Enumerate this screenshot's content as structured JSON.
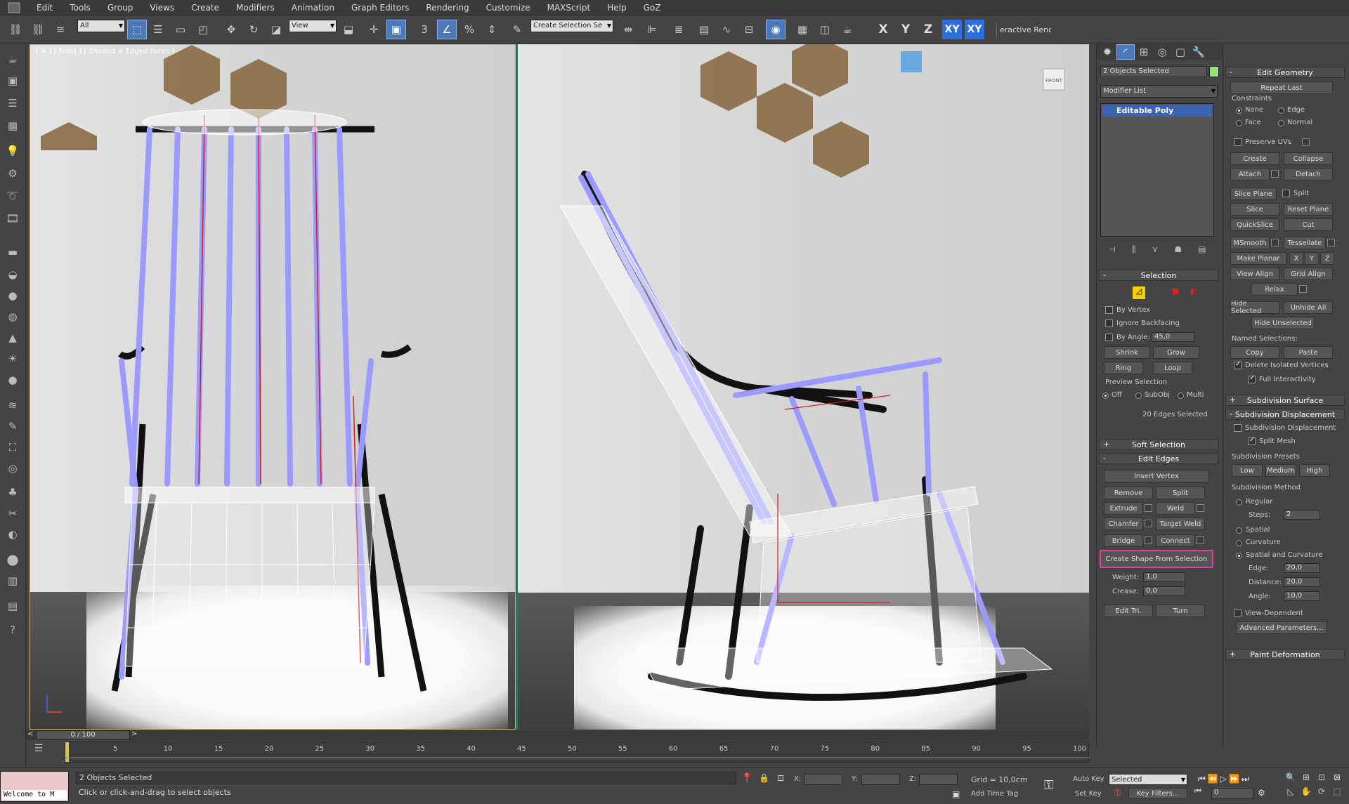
{
  "menu": [
    "Edit",
    "Tools",
    "Group",
    "Views",
    "Create",
    "Modifiers",
    "Animation",
    "Graph Editors",
    "Rendering",
    "Customize",
    "MAXScript",
    "Help",
    "GoZ"
  ],
  "toolbar": {
    "filter": "All",
    "ref_coord": "View",
    "named_sel": "Create Selection Se",
    "axes": [
      "X",
      "Y",
      "Z",
      "XY",
      "XY"
    ],
    "render_label": "eractive Rend"
  },
  "viewport_left": {
    "label": "[ + ] [ Front ] [ Shaded + Edged Faces ]"
  },
  "viewport_right": {
    "viewcube": "FRONT"
  },
  "panel": {
    "objects_selected": "2 Objects Selected",
    "modifier_list": "Modifier List",
    "stack_item": "Editable Poly",
    "selection": {
      "title": "Selection",
      "by_vertex": "By Vertex",
      "ignore_backfacing": "Ignore Backfacing",
      "by_angle": "By Angle:",
      "angle_value": "45,0",
      "shrink": "Shrink",
      "grow": "Grow",
      "ring": "Ring",
      "loop": "Loop",
      "preview": "Preview Selection",
      "off": "Off",
      "subobj": "SubObj",
      "multi": "Multi",
      "status": "20 Edges Selected"
    },
    "soft_selection": "Soft Selection",
    "edit_edges": {
      "title": "Edit Edges",
      "insert_vertex": "Insert Vertex",
      "remove": "Remove",
      "split": "Split",
      "extrude": "Extrude",
      "weld": "Weld",
      "chamfer": "Chamfer",
      "target_weld": "Target Weld",
      "bridge": "Bridge",
      "connect": "Connect",
      "create_shape": "Create Shape From Selection",
      "weight_label": "Weight:",
      "weight": "1,0",
      "crease_label": "Crease:",
      "crease": "0,0",
      "edit_tri": "Edit Tri.",
      "turn": "Turn"
    },
    "edit_geometry": {
      "title": "Edit Geometry",
      "repeat_last": "Repeat Last",
      "constraints": "Constraints",
      "none": "None",
      "edge": "Edge",
      "face": "Face",
      "normal": "Normal",
      "preserve_uvs": "Preserve UVs",
      "create": "Create",
      "collapse": "Collapse",
      "attach": "Attach",
      "detach": "Detach",
      "slice_plane": "Slice Plane",
      "split": "Split",
      "slice": "Slice",
      "reset_plane": "Reset Plane",
      "quickslice": "QuickSlice",
      "cut": "Cut",
      "msmooth": "MSmooth",
      "tessellate": "Tessellate",
      "make_planar": "Make Planar",
      "x": "X",
      "y": "Y",
      "z": "Z",
      "view_align": "View Align",
      "grid_align": "Grid Align",
      "relax": "Relax",
      "hide_selected": "Hide Selected",
      "unhide_all": "Unhide All",
      "hide_unselected": "Hide Unselected",
      "named_selections": "Named Selections:",
      "copy": "Copy",
      "paste": "Paste",
      "delete_isolated": "Delete Isolated Vertices",
      "full_interactivity": "Full Interactivity"
    },
    "subdivision_surface": "Subdivision Surface",
    "subdivision_displacement": {
      "title": "Subdivision Displacement",
      "sub_disp": "Subdivision Displacement",
      "split_mesh": "Split Mesh",
      "presets": "Subdivision Presets",
      "low": "Low",
      "medium": "Medium",
      "high": "High",
      "method": "Subdivision Method",
      "regular": "Regular",
      "steps_label": "Steps:",
      "steps": "2",
      "spatial": "Spatial",
      "curvature": "Curvature",
      "spatial_curvature": "Spatial and Curvature",
      "edge_label": "Edge:",
      "edge": "20,0",
      "distance_label": "Distance:",
      "distance": "20,0",
      "angle_label": "Angle:",
      "angle": "10,0",
      "view_dependent": "View-Dependent",
      "advanced": "Advanced Parameters..."
    },
    "paint_deformation": "Paint Deformation"
  },
  "timeline": {
    "frame": "0 / 100",
    "ticks": [
      "5",
      "10",
      "15",
      "20",
      "25",
      "30",
      "35",
      "40",
      "45",
      "50",
      "55",
      "60",
      "65",
      "70",
      "75",
      "80",
      "85",
      "90",
      "95",
      "100"
    ]
  },
  "status": {
    "welcome": "Welcome to M",
    "objects": "2 Objects Selected",
    "prompt": "Click or click-and-drag to select objects",
    "x": "X:",
    "y": "Y:",
    "z": "Z:",
    "grid": "Grid = 10,0cm",
    "add_time_tag": "Add Time Tag",
    "auto_key": "Auto Key",
    "set_key": "Set Key",
    "selected": "Selected",
    "key_filters": "Key Filters...",
    "frame_value": "0"
  },
  "colors": {
    "accent": "#4a78b8",
    "highlight": "#e040a0",
    "poly": "#9a9aff",
    "edge_sel": "#d02020"
  }
}
